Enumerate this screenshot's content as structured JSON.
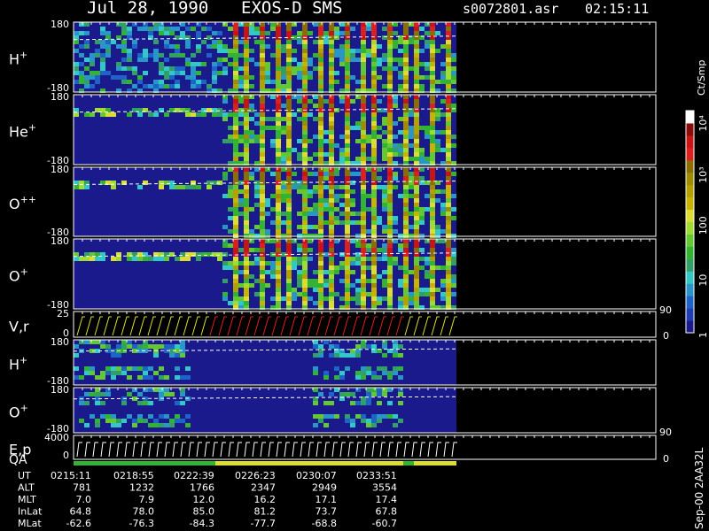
{
  "header": {
    "date": "Jul 28, 1990",
    "instrument": "EXOS-D SMS",
    "file": "s0072801.asr",
    "time": "02:15:11"
  },
  "colorbar": {
    "unit": "Ct/Smp",
    "ticks": [
      {
        "label": "1",
        "value": 1
      },
      {
        "label": "10",
        "value": 10
      },
      {
        "label": "100",
        "value": 100
      },
      {
        "label": "10³",
        "value": 1000
      },
      {
        "label": "10⁴",
        "value": 10000
      }
    ],
    "colors": [
      "#1a1a8c",
      "#1f3cb4",
      "#1e64c8",
      "#2896c8",
      "#32c8c8",
      "#32a064",
      "#32b432",
      "#64c832",
      "#a0dc32",
      "#dcdc32",
      "#c8b400",
      "#b4a000",
      "#a08c00",
      "#8c6e00",
      "#dc2020",
      "#c81414",
      "#8c0a0a",
      "#ffffff"
    ]
  },
  "side_labels": {
    "vr_right_top": "90",
    "vr_right_bottom": "0",
    "ep_right_top": "90",
    "ep_right_bottom": "0",
    "footer_id": "Sep-00 2AA32L"
  },
  "chart_data": {
    "type": "heatmap",
    "panels": [
      {
        "label": "H",
        "superscript": "+",
        "ymin_label": "-180",
        "ymax_label": "180"
      },
      {
        "label": "He",
        "superscript": "+",
        "ymin_label": "-180",
        "ymax_label": "180"
      },
      {
        "label": "O",
        "superscript": "++",
        "ymin_label": "-180",
        "ymax_label": "180"
      },
      {
        "label": "O",
        "superscript": "+",
        "ymin_label": "-180",
        "ymax_label": "180"
      },
      {
        "label": "V,r",
        "superscript": "",
        "ymin_label": "0",
        "ymax_label": "25"
      },
      {
        "label": "H",
        "superscript": "+",
        "ymin_label": "-180",
        "ymax_label": "180"
      },
      {
        "label": "O",
        "superscript": "+",
        "ymin_label": "-180",
        "ymax_label": "180"
      },
      {
        "label": "E,p",
        "superscript": "",
        "ymin_label": "0",
        "ymax_label": "4000"
      }
    ],
    "qa_label": "QA",
    "ephemeris": {
      "rows": [
        {
          "name": "UT",
          "values": [
            "0215:11",
            "0218:55",
            "0222:39",
            "0226:23",
            "0230:07",
            "0233:51"
          ]
        },
        {
          "name": "ALT",
          "values": [
            "781",
            "1232",
            "1766",
            "2347",
            "2949",
            "3554"
          ]
        },
        {
          "name": "MLT",
          "values": [
            "7.0",
            "7.9",
            "12.0",
            "16.2",
            "17.1",
            "17.4"
          ]
        },
        {
          "name": "InLat",
          "values": [
            "64.8",
            "78.0",
            "85.0",
            "81.2",
            "73.7",
            "67.8"
          ]
        },
        {
          "name": "MLat",
          "values": [
            "-62.6",
            "-76.3",
            "-84.3",
            "-77.7",
            "-68.8",
            "-60.7"
          ]
        }
      ]
    }
  }
}
